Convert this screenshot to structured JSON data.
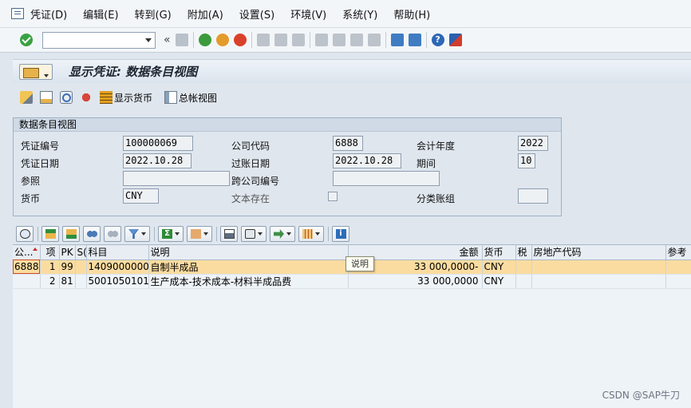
{
  "menu": [
    "凭证(D)",
    "编辑(E)",
    "转到(G)",
    "附加(A)",
    "设置(S)",
    "环境(V)",
    "系统(Y)",
    "帮助(H)"
  ],
  "command_field": {
    "value": ""
  },
  "page_title": "显示凭证: 数据条目视图",
  "app_toolbar": {
    "display_currency": "显示货币",
    "gl_view": "总帐视图"
  },
  "header": {
    "title": "数据条目视图",
    "doc_no_label": "凭证编号",
    "doc_no": "100000069",
    "company_label": "公司代码",
    "company": "6888",
    "fiscal_year_label": "会计年度",
    "fiscal_year": "2022",
    "doc_date_label": "凭证日期",
    "doc_date": "2022.10.28",
    "post_date_label": "过账日期",
    "post_date": "2022.10.28",
    "period_label": "期间",
    "period": "10",
    "reference_label": "参照",
    "reference": "",
    "cross_cc_label": "跨公司编号",
    "cross_cc": "",
    "currency_label": "货币",
    "currency": "CNY",
    "text_exists_label": "文本存在",
    "ledger_group_label": "分类账组",
    "ledger_group": ""
  },
  "grid": {
    "columns": [
      "公...",
      "项",
      "PK",
      "S(",
      "科目",
      "说明",
      "金额",
      "货币",
      "税",
      "房地产代码",
      "参考"
    ],
    "rows": [
      {
        "company": "6888",
        "item": "1",
        "pk": "99",
        "s": "",
        "account": "1409000000",
        "text": "自制半成品",
        "amount": "33 000,0000-",
        "currency": "CNY",
        "tax": "",
        "re": "",
        "ref": ""
      },
      {
        "company": "",
        "item": "2",
        "pk": "81",
        "s": "",
        "account": "5001050101",
        "text": "生产成本-技术成本-材料半成品费",
        "amount": "33 000,0000",
        "currency": "CNY",
        "tax": "",
        "re": "",
        "ref": ""
      }
    ]
  },
  "tooltip": "说明",
  "watermark": "CSDN @SAP牛刀",
  "colors": {
    "selected_row": "#fbdca0",
    "accent": "#d24b2b"
  }
}
